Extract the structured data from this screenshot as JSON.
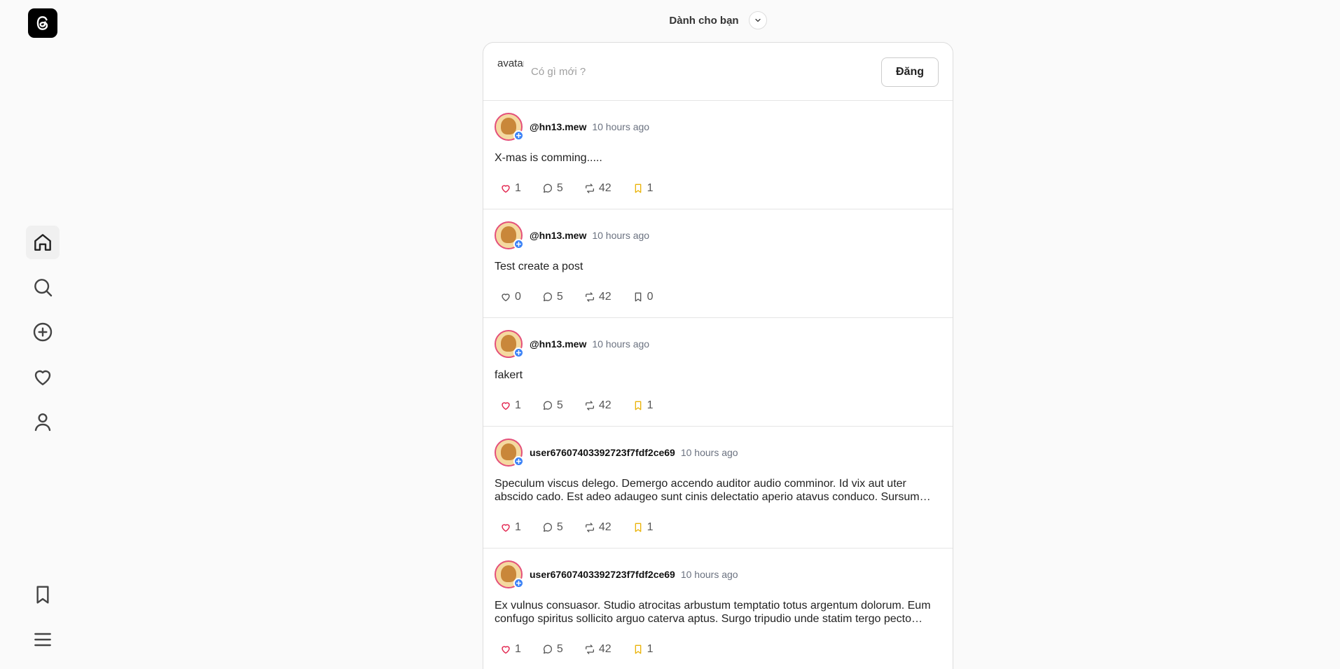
{
  "header": {
    "title": "Dành cho bạn"
  },
  "sidebar": {
    "logo": "threads-logo",
    "items": [
      {
        "name": "home",
        "icon": "home-icon"
      },
      {
        "name": "search",
        "icon": "search-icon"
      },
      {
        "name": "create",
        "icon": "plus-circle-icon"
      },
      {
        "name": "activity",
        "icon": "heart-icon"
      },
      {
        "name": "profile",
        "icon": "user-icon"
      },
      {
        "name": "saved",
        "icon": "bookmark-icon"
      },
      {
        "name": "menu",
        "icon": "menu-icon"
      }
    ]
  },
  "composer": {
    "avatar_alt": "avatar",
    "placeholder": "Có gì mới ?",
    "post_label": "Đăng"
  },
  "colors": {
    "like_red": "#e11d48",
    "bookmark_yellow": "#eab308",
    "badge_blue": "#3b82f6"
  },
  "posts": [
    {
      "user": "@hn13.mew",
      "time": "10 hours ago",
      "text": "X-mas is comming.....",
      "likes": "1",
      "comments": "5",
      "reposts": "42",
      "saves": "1",
      "liked": true,
      "saved": true
    },
    {
      "user": "@hn13.mew",
      "time": "10 hours ago",
      "text": "Test create a post",
      "likes": "0",
      "comments": "5",
      "reposts": "42",
      "saves": "0",
      "liked": false,
      "saved": false
    },
    {
      "user": "@hn13.mew",
      "time": "10 hours ago",
      "text": "fakert",
      "likes": "1",
      "comments": "5",
      "reposts": "42",
      "saves": "1",
      "liked": true,
      "saved": true
    },
    {
      "user": "user67607403392723f7fdf2ce69",
      "time": "10 hours ago",
      "text": "Speculum viscus delego. Demergo accendo auditor audio comminor. Id vix aut uter abscido cado. Est adeo adaugeo sunt cinis delectatio aperio atavus conduco. Sursum…",
      "likes": "1",
      "comments": "5",
      "reposts": "42",
      "saves": "1",
      "liked": true,
      "saved": true
    },
    {
      "user": "user67607403392723f7fdf2ce69",
      "time": "10 hours ago",
      "text": "Ex vulnus consuasor. Studio atrocitas arbustum temptatio totus argentum dolorum. Eum confugo spiritus sollicito arguo caterva aptus. Surgo tripudio unde statim tergo pecto…",
      "likes": "1",
      "comments": "5",
      "reposts": "42",
      "saves": "1",
      "liked": true,
      "saved": true
    }
  ]
}
